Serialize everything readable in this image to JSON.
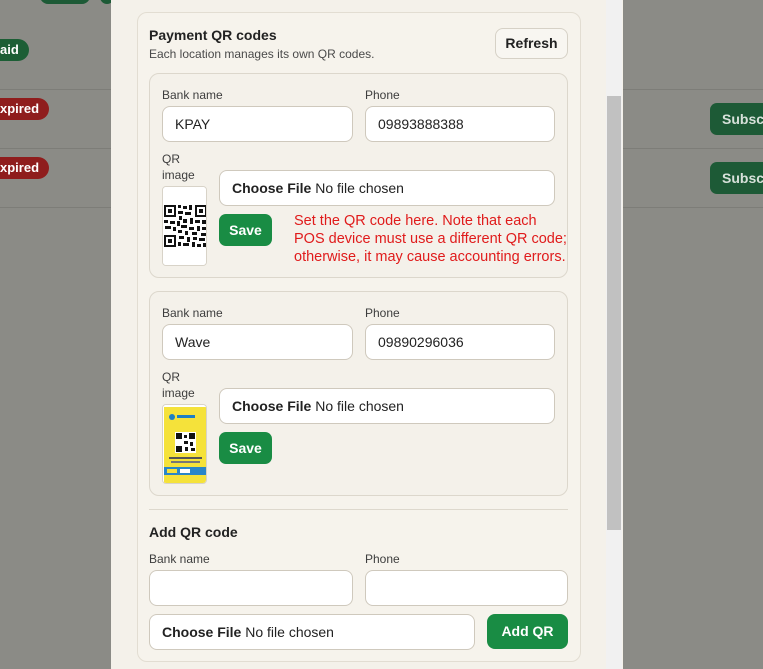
{
  "background": {
    "badges": [
      "aid",
      "xpired",
      "xpired"
    ],
    "subscribe_label": "Subscr"
  },
  "panel": {
    "title": "Payment QR codes",
    "subtitle": "Each location manages its own QR codes.",
    "refresh_label": "Refresh"
  },
  "labels": {
    "bank_name": "Bank name",
    "phone": "Phone",
    "qr_image": "QR image",
    "save": "Save",
    "choose_file": "Choose File",
    "no_file": "No file chosen"
  },
  "qr_codes": [
    {
      "bank_name": "KPAY",
      "phone": "09893888388"
    },
    {
      "bank_name": "Wave",
      "phone": "09890296036"
    }
  ],
  "annotation": "Set the QR code here. Note that each POS device must use a different QR code; otherwise, it may cause accounting errors.",
  "add_qr": {
    "title": "Add QR code",
    "bank_name_value": "",
    "phone_value": "",
    "button_label": "Add QR"
  },
  "colors": {
    "accent_green": "#198c44",
    "annotation_red": "#e01b1b"
  }
}
